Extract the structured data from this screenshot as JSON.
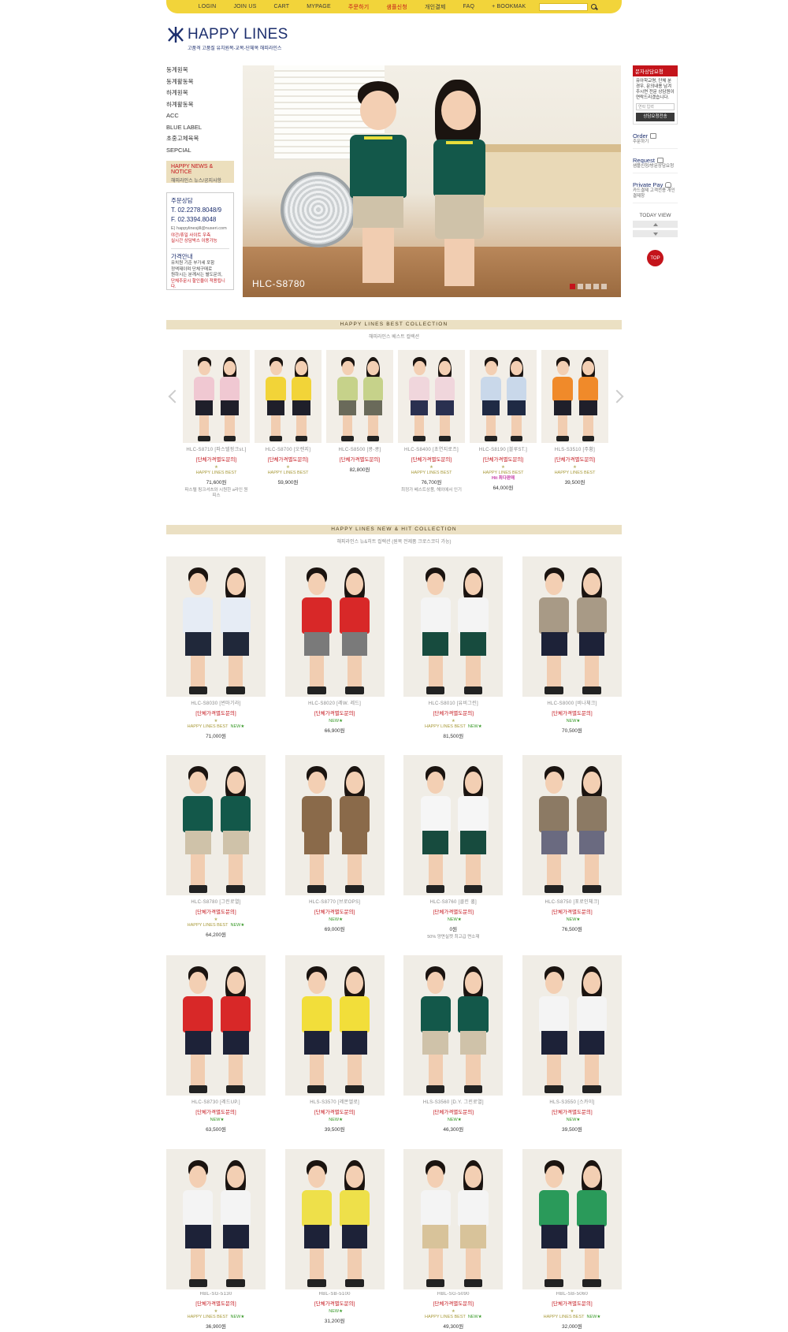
{
  "topnav": {
    "items": [
      {
        "label": "LOGIN",
        "red": false
      },
      {
        "label": "JOIN US",
        "red": false
      },
      {
        "label": "CART",
        "red": false
      },
      {
        "label": "MYPAGE",
        "red": false
      },
      {
        "label": "주문하기",
        "red": true
      },
      {
        "label": "샘플신청",
        "red": true
      },
      {
        "label": "개인결제",
        "red": false
      },
      {
        "label": "FAQ",
        "red": false
      },
      {
        "label": "+ BOOKMAK",
        "red": false
      }
    ]
  },
  "logo": {
    "name": "HAPPY LINES",
    "subtitle": "고품격 고품질 유치원복-교복-단체복 해피라인스"
  },
  "left_menu": {
    "categories": [
      "동계원복",
      "동계활동복",
      "하계원복",
      "하계활동복",
      "ACC",
      "BLUE LABEL",
      "초중고체육복",
      "SEPCIAL"
    ],
    "news_title": "HAPPY NEWS & NOTICE",
    "news_sub": "해피라인스 뉴스/공지사항",
    "contact": {
      "heading": "주문상담",
      "tel": "T. 02.2278.8048/9",
      "fax": "F. 02.3394.8048",
      "email": "E) happylinesjill@nuseri.com",
      "note_1": "야간/휴일 사이트 우측",
      "note_2": "실시간 상담박스 이용가능",
      "price_heading": "가격안내",
      "price_1": "유치원 기준 부가세 포함",
      "price_2": "정액제이며 단체구매로",
      "price_3": "원하시는 분께서는 별도문의,",
      "price_4": "단체주문시 할인율이 적용됩니다."
    }
  },
  "hero": {
    "code": "HLC-S8780"
  },
  "quick_menu": {
    "head": "문자상담요청",
    "body": "유아학교명, 단체 분 경우, 문의내용 남겨주시면 전문 상담원이 연락드리겠습니다.",
    "input_placeholder": "연락 입력",
    "button": "상담요청전송",
    "order_title": "Order",
    "order_sub": "주문하기",
    "request_title": "Request",
    "request_sub": "샘플신청/방문상담요청",
    "pay_title": "Private Pay",
    "pay_sub": "카드결제 고객전용 개인결제창",
    "today_view": "TODAY VIEW",
    "top": "TOP"
  },
  "best": {
    "title": "HAPPY LINES BEST COLLECTION",
    "subtitle": "해피라인스 베스트 컬렉션",
    "items": [
      {
        "name": "HLC-S8710 [파스텔핑크st.]",
        "ask": "[단체가격별도문의]",
        "best": "HAPPY LINES BEST",
        "new": "",
        "hit": "",
        "price": "71,600원",
        "desc": "파스텔 핑크셔츠와 시원한 a라인 원피스",
        "c1": "#f0c8d2",
        "c2": "#1f1f2a"
      },
      {
        "name": "HLC-S8700 [오렌지]",
        "ask": "[단체가격별도문의]",
        "best": "HAPPY LINES BEST",
        "new": "",
        "hit": "",
        "price": "59,900원",
        "desc": "",
        "c1": "#f2d438",
        "c2": "#1f1f2a"
      },
      {
        "name": "HLC-S8500 [콩-콩]",
        "ask": "[단체가격별도문의]",
        "best": "",
        "new": "",
        "hit": "",
        "price": "82,800원",
        "desc": "",
        "c1": "#c6d28a",
        "c2": "#6a6a5a"
      },
      {
        "name": "HLC-S8400 [초연지로즈]",
        "ask": "[단체가격별도문의]",
        "best": "HAPPY LINES BEST",
        "new": "",
        "hit": "",
        "price": "76,700원",
        "desc": "최정가 베스트상품, 해외에서 인기",
        "c1": "#f0d6dc",
        "c2": "#2a3050"
      },
      {
        "name": "HLC-S8190 [블루ST.]",
        "ask": "[단체가격별도문의]",
        "best": "HAPPY LINES BEST",
        "new": "",
        "hit": "Hit 최다판매",
        "price": "64,000원",
        "desc": "",
        "c1": "#c9d8ea",
        "c2": "#1f2a44"
      },
      {
        "name": "HLS-S3510 [주황]",
        "ask": "[단체가격별도문의]",
        "best": "HAPPY LINES BEST",
        "new": "",
        "hit": "",
        "price": "39,500원",
        "desc": "",
        "c1": "#f08a2a",
        "c2": "#1f1f2a"
      }
    ]
  },
  "newhit": {
    "title": "HAPPY LINES NEW & HIT COLLECTION",
    "subtitle": "해피라인스 뉴&히트 컬렉션 (원복 전제품 크로스코디 가능)",
    "rows": [
      [
        {
          "name": "HLC-S8030 [썬마기라]",
          "ask": "[단체가격별도문의]",
          "best": "HAPPY LINES BEST",
          "new": "NEW★",
          "price": "71,000원",
          "desc": "",
          "c1": "#e6ecf5",
          "c2": "#20283a"
        },
        {
          "name": "HLC-S8020 [레W. 레드]",
          "ask": "[단체가격별도문의]",
          "best": "",
          "new": "NEW★",
          "price": "66,900원",
          "desc": "",
          "c1": "#d82828",
          "c2": "#7a7a7a"
        },
        {
          "name": "HLC-S8010 [유비그린]",
          "ask": "[단체가격별도문의]",
          "best": "HAPPY LINES BEST",
          "new": "NEW★",
          "price": "81,500원",
          "desc": "",
          "c1": "#f4f4f4",
          "c2": "#174b3e"
        },
        {
          "name": "HLC-S8000 [비나체크]",
          "ask": "[단체가격별도문의]",
          "best": "",
          "new": "NEW★",
          "price": "70,500원",
          "desc": "",
          "c1": "#a89a86",
          "c2": "#1d2238"
        }
      ],
      [
        {
          "name": "HLC-S8780 [그린로열]",
          "ask": "[단체가격별도문의]",
          "best": "HAPPY LINES BEST",
          "new": "NEW★",
          "price": "64,200원",
          "desc": "",
          "c1": "#13584a",
          "c2": "#cfc2a9"
        },
        {
          "name": "HLC-S8770 [브로OPS]",
          "ask": "[단체가격별도문의]",
          "best": "",
          "new": "NEW★",
          "price": "69,000원",
          "desc": "",
          "c1": "#8a6a4a",
          "c2": "#8a6a4a"
        },
        {
          "name": "HLC-S8760 [클린 퀼]",
          "ask": "[단체가격별도문의]",
          "best": "",
          "new": "NEW★",
          "price": "0원",
          "desc": "50% 양면실켓 최고급 면소재",
          "c1": "#f6f6f6",
          "c2": "#174b3e"
        },
        {
          "name": "HLC-S8750 [포로인체크]",
          "ask": "[단체가격별도문의]",
          "best": "",
          "new": "NEW★",
          "price": "76,500원",
          "desc": "",
          "c1": "#8c7a64",
          "c2": "#6a6a80"
        }
      ],
      [
        {
          "name": "HLC-S8730 [레드UP.]",
          "ask": "[단체가격별도문의]",
          "best": "",
          "new": "NEW★",
          "price": "63,500원",
          "desc": "",
          "c1": "#d82828",
          "c2": "#1d2238"
        },
        {
          "name": "HLS-S3570 [레몬엘로]",
          "ask": "[단체가격별도문의]",
          "best": "",
          "new": "NEW★",
          "price": "39,500원",
          "desc": "",
          "c1": "#f2de3a",
          "c2": "#1d2238"
        },
        {
          "name": "HLS-S3560 [D.Y. 그린로열]",
          "ask": "[단체가격별도문의]",
          "best": "",
          "new": "NEW★",
          "price": "46,300원",
          "desc": "",
          "c1": "#13584a",
          "c2": "#cfc2a9"
        },
        {
          "name": "HLS-S3550 [스카이]",
          "ask": "[단체가격별도문의]",
          "best": "",
          "new": "NEW★",
          "price": "39,500원",
          "desc": "",
          "c1": "#f4f4f4",
          "c2": "#1d2238"
        }
      ],
      [
        {
          "name": "HBL-SG-5130",
          "ask": "[단체가격별도문의]",
          "best": "HAPPY LINES BEST",
          "new": "NEW★",
          "price": "36,900원",
          "desc": "",
          "c1": "#f4f4f4",
          "c2": "#1d2238"
        },
        {
          "name": "HBL-SB-5100",
          "ask": "[단체가격별도문의]",
          "best": "",
          "new": "NEW★",
          "price": "31,200원",
          "desc": "",
          "c1": "#eee04a",
          "c2": "#1d2238"
        },
        {
          "name": "HBL-SG-5090",
          "ask": "[단체가격별도문의]",
          "best": "HAPPY LINES BEST",
          "new": "NEW★",
          "price": "49,300원",
          "desc": "",
          "c1": "#f4f4f4",
          "c2": "#d8c39a"
        },
        {
          "name": "HBL-SB-5060",
          "ask": "[단체가격별도문의]",
          "best": "HAPPY LINES BEST",
          "new": "NEW★",
          "price": "32,000원",
          "desc": "",
          "c1": "#2a9a5a",
          "c2": "#1d2238"
        }
      ]
    ]
  },
  "colors": {
    "nav_yellow": "#f2d43a",
    "brand_navy": "#1d2f6e",
    "accent_red": "#c4141b",
    "section_bar": "#ebe0c3"
  }
}
